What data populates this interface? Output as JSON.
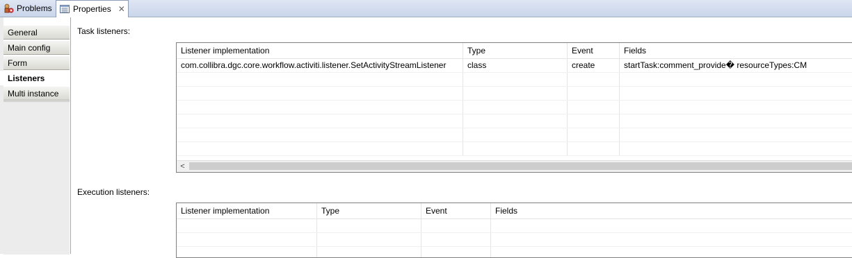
{
  "tabs": [
    {
      "label": "Problems",
      "icon": "problems-icon"
    },
    {
      "label": "Properties",
      "icon": "properties-icon",
      "close": "✕"
    }
  ],
  "sidebar": {
    "items": [
      {
        "label": "General"
      },
      {
        "label": "Main config"
      },
      {
        "label": "Form"
      },
      {
        "label": "Listeners",
        "selected": true
      },
      {
        "label": "Multi instance"
      }
    ]
  },
  "task_listeners": {
    "label": "Task listeners:",
    "columns": [
      "Listener implementation",
      "Type",
      "Event",
      "Fields"
    ],
    "rows": [
      [
        "com.collibra.dgc.core.workflow.activiti.listener.SetActivityStreamListener",
        "class",
        "create",
        "startTask:comment_provide� resourceTypes:CM"
      ]
    ],
    "scroll_left": "<"
  },
  "execution_listeners": {
    "label": "Execution listeners:",
    "columns": [
      "Listener implementation",
      "Type",
      "Event",
      "Fields"
    ]
  }
}
